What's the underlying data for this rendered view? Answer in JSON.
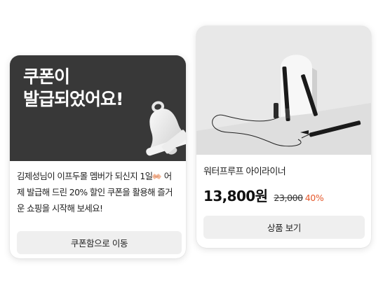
{
  "coupon_card": {
    "title": "쿠폰이\n발급되었어요!",
    "message_1": "김제성님이 이프두몰 멤버가 되신지 1일",
    "message_2": "어제 발급해 드린 20% 할인 쿠폰을 활용해 즐거운 쇼핑을 시작해 보세요!",
    "button_label": "쿠폰함으로 이동",
    "bell_icon": "bell-icon",
    "handshake_icon": "handshake-emoji"
  },
  "product_card": {
    "name": "워터프루프 아이라이너",
    "price": "13,800원",
    "original_price": "23,000",
    "discount": "40%",
    "button_label": "상품 보기",
    "colors": {
      "discount": "#e5582b",
      "hero": "#383838"
    }
  }
}
